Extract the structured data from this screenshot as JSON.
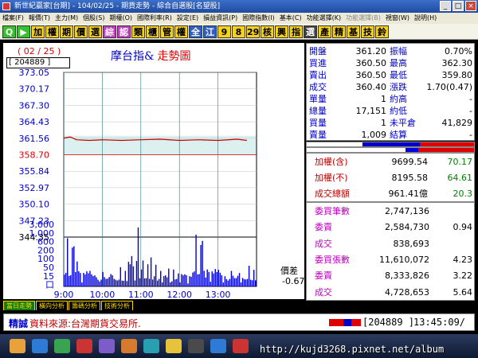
{
  "window": {
    "title": "新世紀贏家[台期] - 104/02/25 - 期貨走勢 - 綜合自選股[名望股]",
    "buttons": [
      "_",
      "□",
      "×"
    ]
  },
  "menu": {
    "items": [
      "檔案(F)",
      "報價(T)",
      "主力(M)",
      "個股(S)",
      "期權(O)",
      "國際利率(R)",
      "設定(E)",
      "損益資訊(P)",
      "國際指數(I)",
      "基本(C)",
      "功能選擇(K)",
      "功能選擇(B)",
      "視窗(W)",
      "說明(H)"
    ],
    "dim_index": 11
  },
  "toolbar": {
    "buttons": [
      {
        "label": "Q",
        "style": "icon"
      },
      {
        "label": "▶",
        "style": "icon"
      },
      {
        "label": "加",
        "style": "y"
      },
      {
        "label": "權",
        "style": "y"
      },
      {
        "label": "期",
        "style": "y"
      },
      {
        "label": "價",
        "style": "y"
      },
      {
        "label": "選",
        "style": "y"
      },
      {
        "label": "綜",
        "style": "p"
      },
      {
        "label": "認",
        "style": "p"
      },
      {
        "label": "類",
        "style": "y"
      },
      {
        "label": "櫃",
        "style": "y"
      },
      {
        "label": "管",
        "style": "y"
      },
      {
        "label": "權",
        "style": "y"
      },
      {
        "label": "全",
        "style": "b"
      },
      {
        "label": "江",
        "style": "b"
      },
      {
        "label": "9",
        "style": "y"
      },
      {
        "label": "8",
        "style": "y"
      },
      {
        "label": "29",
        "style": "y"
      },
      {
        "label": "核",
        "style": "y"
      },
      {
        "label": "興",
        "style": "y"
      },
      {
        "label": "指",
        "style": "y"
      },
      {
        "label": "選",
        "style": "k"
      },
      {
        "label": "產",
        "style": "y"
      },
      {
        "label": "精",
        "style": "y"
      },
      {
        "label": "基",
        "style": "y"
      },
      {
        "label": "技",
        "style": "y"
      },
      {
        "label": "鈴",
        "style": "y"
      }
    ]
  },
  "chart_header": {
    "date": "( 02 / 25 )",
    "code": "[ 204889 ]",
    "title_a": "摩台指&",
    "title_b": "走勢圖"
  },
  "chart_data": {
    "type": "line",
    "title": "摩台指& 走勢圖",
    "x_ticks": [
      "9:00",
      "10:00",
      "11:00",
      "12:00",
      "13:00"
    ],
    "price_ticks": [
      "373.05",
      "370.17",
      "367.30",
      "364.43",
      "361.56",
      "358.70",
      "355.84",
      "352.97",
      "350.10",
      "347.23",
      "344.35"
    ],
    "price_ylim": [
      344.35,
      373.05
    ],
    "reference_price": 358.7,
    "volume_ticks": [
      "3,000",
      "1,000",
      "600",
      "200",
      "100",
      "50",
      "15",
      "口"
    ],
    "price_series": {
      "name": "price",
      "x_minutes": [
        0,
        10,
        20,
        40,
        60,
        90,
        120,
        150,
        180,
        210,
        240,
        270,
        285
      ],
      "values": [
        361.6,
        361.8,
        361.3,
        361.2,
        361.3,
        361.2,
        361.3,
        361.4,
        361.2,
        361.3,
        361.2,
        361.4,
        361.2
      ]
    },
    "volume_series": {
      "name": "volume",
      "values": [
        120,
        80,
        200,
        90,
        60,
        150,
        300,
        70,
        90,
        100,
        60,
        40,
        80,
        50,
        130,
        70,
        60,
        90,
        50,
        40,
        60,
        30,
        50,
        40,
        60,
        80,
        40,
        30,
        70,
        60,
        40,
        50,
        30,
        60,
        40,
        80,
        50,
        30,
        60,
        40
      ]
    },
    "diff_label": "價差",
    "diff_value": "-0.67"
  },
  "quote": {
    "rows": [
      {
        "l1": "開盤",
        "v1": "361.20",
        "l2": "振幅",
        "v2": "0.70%"
      },
      {
        "l1": "買進",
        "v1": "360.50",
        "l2": "最高",
        "v2": "362.30"
      },
      {
        "l1": "賣出",
        "v1": "360.50",
        "l2": "最低",
        "v2": "359.80"
      },
      {
        "l1": "成交",
        "v1": "360.40",
        "l2": "漲跌",
        "v2": "1.70(0.47)"
      },
      {
        "l1": "單量",
        "v1": "1",
        "l2": "約高",
        "v2": "-"
      },
      {
        "l1": "總量",
        "v1": "17,151",
        "l2": "約低",
        "v2": "-"
      },
      {
        "l1": "買量",
        "v1": "1",
        "l2": "未平倉",
        "v2": "41,829"
      },
      {
        "l1": "賣量",
        "v1": "1,009",
        "l2": "結算",
        "v2": "-"
      }
    ]
  },
  "futures": {
    "rows": [
      {
        "label": "加權(含)",
        "value": "9699.54",
        "value2": "70.17"
      },
      {
        "label": "加權(不)",
        "value": "8195.58",
        "value2": "64.61"
      },
      {
        "label": "成交總額",
        "value": "961.41億",
        "value2": "20.3"
      }
    ]
  },
  "volume": {
    "rows": [
      {
        "label": "委買筆數",
        "value": "2,747,136",
        "value2": ""
      },
      {
        "label": "委賣",
        "value": "2,584,730",
        "value2": "0.94"
      },
      {
        "label": "成交",
        "value": "838,693",
        "value2": ""
      },
      {
        "label": "委買張數",
        "value": "11,610,072",
        "value2": "4.23"
      },
      {
        "label": "委賣",
        "value": "8,333,826",
        "value2": "3.22"
      },
      {
        "label": "成交",
        "value": "4,728,653",
        "value2": "5.64"
      }
    ]
  },
  "tabs": [
    "當日走勢",
    "橫向分析",
    "籌碼分析",
    "技術分析"
  ],
  "status": {
    "label": "精誠",
    "text": "資料來源:台灣期貨交易所.",
    "code": "[204889 ]",
    "time": "13:45:09/"
  },
  "watermark": "http://kujd3268.pixnet.net/album",
  "colors": {
    "up": "#d00000",
    "label": "#0000c8",
    "brand": "#c00000"
  }
}
